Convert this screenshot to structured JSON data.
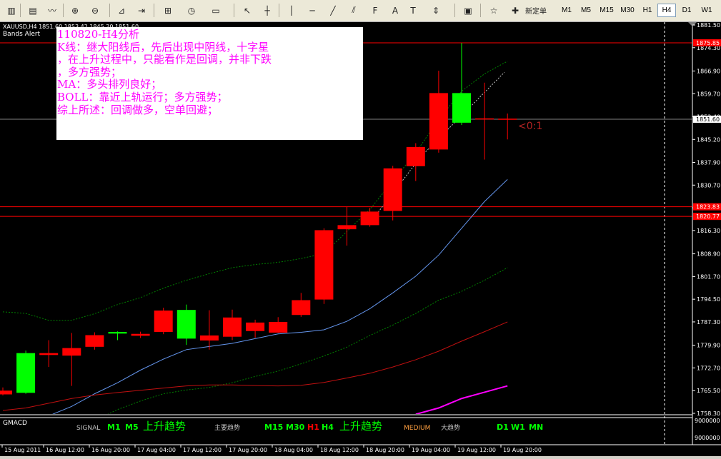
{
  "toolbar": {
    "buttons": [
      {
        "name": "bar-chart-icon",
        "glyph": "▥"
      },
      {
        "name": "candlestick-chart-icon",
        "glyph": "▤"
      },
      {
        "name": "line-chart-icon",
        "glyph": "〰"
      },
      {
        "name": "zoom-in-icon",
        "glyph": "⊕"
      },
      {
        "name": "zoom-out-icon",
        "glyph": "⊖"
      },
      {
        "name": "chart-shift-icon",
        "glyph": "⊿"
      },
      {
        "name": "autoscroll-icon",
        "glyph": "⇥"
      },
      {
        "name": "indicators-icon",
        "glyph": "⊞"
      },
      {
        "name": "periods-icon",
        "glyph": "◷"
      },
      {
        "name": "templates-icon",
        "glyph": "▭"
      },
      {
        "name": "cursor-icon",
        "glyph": "↖"
      },
      {
        "name": "crosshair-icon",
        "glyph": "┼"
      },
      {
        "name": "vertical-line-icon",
        "glyph": "│"
      },
      {
        "name": "horizontal-line-icon",
        "glyph": "─"
      },
      {
        "name": "trendline-icon",
        "glyph": "╱"
      },
      {
        "name": "equidistant-channel-icon",
        "glyph": "⫽"
      },
      {
        "name": "fibonacci-icon",
        "glyph": "F"
      },
      {
        "name": "text-icon",
        "glyph": "A"
      },
      {
        "name": "text-label-icon",
        "glyph": "T"
      },
      {
        "name": "arrows-icon",
        "glyph": "⇕"
      },
      {
        "name": "terminal-icon",
        "glyph": "▣"
      },
      {
        "name": "favorites-icon",
        "glyph": "☆"
      },
      {
        "name": "new-order-icon",
        "glyph": "✚"
      }
    ],
    "new_order_label": "新定单",
    "timeframes": [
      "M1",
      "M5",
      "M15",
      "M30",
      "H1",
      "H4",
      "D1",
      "W1"
    ],
    "active_timeframe": "H4"
  },
  "chart": {
    "symbol_line": "XAUUSD,H4  1851.60 1853.42 1845.20 1851.60",
    "indicator_name": "Bands Alert",
    "note_lines": [
      "110820-H4分析",
      "K线：继大阳线后，先后出现中阴线，十字星",
      "，在上升过程中，只能看作是回调，并非下跌",
      "，多方强势；",
      "MA：多头排列良好；",
      "BOLL：靠近上轨运行；多方强势；",
      "综上所述：回调做多，空单回避；"
    ],
    "price_ticks": [
      "1881.50",
      "1874.30",
      "1866.90",
      "1859.70",
      "1852.40",
      "1845.20",
      "1837.90",
      "1830.70",
      "1823.50",
      "1816.30",
      "1808.90",
      "1801.70",
      "1794.50",
      "1787.30",
      "1779.90",
      "1772.70",
      "1765.50",
      "1758.30"
    ],
    "price_labels": [
      {
        "text": "1875.85",
        "color": "#ff0000"
      },
      {
        "text": "1851.60",
        "color": "#ffffff"
      },
      {
        "text": "1823.83",
        "color": "#ff0000"
      },
      {
        "text": "1820.77",
        "color": "#ff0000"
      }
    ],
    "countdown": "<0:1",
    "sub_window": {
      "name": "GMACD",
      "ticks": [
        "9000000",
        "9000000"
      ],
      "items": [
        {
          "text": "SIGNAL",
          "color": "#c0c0c0",
          "size": 9
        },
        {
          "text": "M1",
          "color": "#00ff00",
          "size": 11
        },
        {
          "text": "M5",
          "color": "#00ff00",
          "size": 11
        },
        {
          "text": "上升趋势",
          "color": "#00ff00",
          "size": 15
        },
        {
          "text": "主要趋势",
          "color": "#c0c0c0",
          "size": 9
        },
        {
          "text": "M15",
          "color": "#00ff00",
          "size": 11
        },
        {
          "text": "M30",
          "color": "#00ff00",
          "size": 11
        },
        {
          "text": "H1",
          "color": "#ff0000",
          "size": 11
        },
        {
          "text": "H4",
          "color": "#00ff00",
          "size": 11
        },
        {
          "text": "上升趋势",
          "color": "#00ff00",
          "size": 15
        },
        {
          "text": "MEDIUM",
          "color": "#ffa040",
          "size": 9
        },
        {
          "text": "大趋势",
          "color": "#c0c0c0",
          "size": 9
        },
        {
          "text": "D1",
          "color": "#00ff00",
          "size": 11
        },
        {
          "text": "W1",
          "color": "#00ff00",
          "size": 11
        },
        {
          "text": "MN",
          "color": "#00ff00",
          "size": 11
        }
      ]
    },
    "time_ticks": [
      "15 Aug 2011",
      "16 Aug 12:00",
      "16 Aug 20:00",
      "17 Aug 04:00",
      "17 Aug 12:00",
      "17 Aug 20:00",
      "18 Aug 04:00",
      "18 Aug 12:00",
      "18 Aug 20:00",
      "19 Aug 04:00",
      "19 Aug 12:00",
      "19 Aug 20:00"
    ],
    "colors": {
      "bull": "#00ff00",
      "bear": "#ff0000",
      "ma_fast": "#6495ed",
      "boll_band": "#008000",
      "ma_slow": "#c01010",
      "ma_long": "#ff00ff",
      "level_line": "#ff0000",
      "grid": "#ffffff"
    }
  },
  "chart_data": {
    "type": "candlestick",
    "symbol": "XAUUSD",
    "timeframe": "H4",
    "ylim": [
      1758.3,
      1881.5
    ],
    "candles": [
      {
        "o": 1765.5,
        "h": 1766.5,
        "l": 1764.0,
        "c": 1764.3
      },
      {
        "o": 1764.8,
        "h": 1778.2,
        "l": 1764.5,
        "c": 1777.4
      },
      {
        "o": 1777.4,
        "h": 1781.5,
        "l": 1773.0,
        "c": 1776.8
      },
      {
        "o": 1779.0,
        "h": 1783.8,
        "l": 1767.0,
        "c": 1776.6
      },
      {
        "o": 1783.1,
        "h": 1784.0,
        "l": 1778.5,
        "c": 1779.4
      },
      {
        "o": 1783.6,
        "h": 1784.3,
        "l": 1781.5,
        "c": 1784.1
      },
      {
        "o": 1783.5,
        "h": 1784.2,
        "l": 1782.2,
        "c": 1782.9
      },
      {
        "o": 1790.9,
        "h": 1791.8,
        "l": 1783.4,
        "c": 1784.1
      },
      {
        "o": 1782.0,
        "h": 1792.8,
        "l": 1780.0,
        "c": 1791.1
      },
      {
        "o": 1783.0,
        "h": 1791.0,
        "l": 1778.5,
        "c": 1781.4
      },
      {
        "o": 1788.7,
        "h": 1791.2,
        "l": 1781.5,
        "c": 1782.6
      },
      {
        "o": 1787.1,
        "h": 1788.0,
        "l": 1782.3,
        "c": 1784.4
      },
      {
        "o": 1787.3,
        "h": 1788.8,
        "l": 1783.8,
        "c": 1783.9
      },
      {
        "o": 1794.2,
        "h": 1796.5,
        "l": 1788.9,
        "c": 1789.5
      },
      {
        "o": 1816.4,
        "h": 1817.0,
        "l": 1793.0,
        "c": 1794.4
      },
      {
        "o": 1818.0,
        "h": 1823.8,
        "l": 1811.5,
        "c": 1816.7
      },
      {
        "o": 1822.3,
        "h": 1823.5,
        "l": 1817.5,
        "c": 1818.0
      },
      {
        "o": 1836.0,
        "h": 1836.8,
        "l": 1819.5,
        "c": 1822.5
      },
      {
        "o": 1842.8,
        "h": 1844.0,
        "l": 1832.0,
        "c": 1836.7
      },
      {
        "o": 1859.9,
        "h": 1867.0,
        "l": 1841.0,
        "c": 1842.0
      },
      {
        "o": 1850.5,
        "h": 1875.8,
        "l": 1849.8,
        "c": 1859.9
      },
      {
        "o": 1851.7,
        "h": 1863.2,
        "l": 1838.8,
        "c": 1851.5
      },
      {
        "o": 1851.6,
        "h": 1853.4,
        "l": 1845.2,
        "c": 1851.6
      }
    ],
    "series": [
      {
        "name": "ma_fast",
        "values": [
          1754.5,
          1756.0,
          1757.5,
          1760.5,
          1764.5,
          1768.0,
          1772.0,
          1775.5,
          1778.5,
          1779.5,
          1780.5,
          1782.0,
          1783.5,
          1784.0,
          1784.8,
          1787.5,
          1791.5,
          1796.5,
          1801.8,
          1808.5,
          1817.0,
          1825.5,
          1832.5
        ]
      },
      {
        "name": "boll_upper",
        "values": [
          1790.5,
          1790.0,
          1787.8,
          1787.8,
          1789.9,
          1792.8,
          1795.0,
          1798.0,
          1800.5,
          1802.6,
          1804.5,
          1805.5,
          1806.2,
          1807.4,
          1809.0,
          1816.0,
          1823.0,
          1832.0,
          1841.0,
          1851.5,
          1860.5,
          1866.0,
          1870.0
        ]
      },
      {
        "name": "boll_lower",
        "values": [
          1750.0,
          1751.0,
          1751.5,
          1753.0,
          1756.0,
          1759.5,
          1762.2,
          1764.5,
          1765.7,
          1766.5,
          1768.0,
          1770.0,
          1771.7,
          1774.0,
          1776.5,
          1779.3,
          1783.0,
          1786.3,
          1790.0,
          1794.2,
          1797.0,
          1800.5,
          1804.5
        ]
      },
      {
        "name": "ma_slow",
        "values": [
          1759.2,
          1760.0,
          1761.5,
          1763.0,
          1764.1,
          1764.9,
          1765.6,
          1766.3,
          1767.0,
          1767.3,
          1767.3,
          1767.1,
          1767.0,
          1767.2,
          1768.1,
          1769.5,
          1771.0,
          1773.0,
          1775.3,
          1778.0,
          1781.2,
          1784.2,
          1787.3
        ]
      },
      {
        "name": "ma_long",
        "values": [
          null,
          null,
          null,
          null,
          null,
          null,
          null,
          null,
          null,
          null,
          null,
          null,
          null,
          null,
          null,
          null,
          null,
          null,
          1758.0,
          1760.0,
          1763.0,
          1765.0,
          1767.0
        ]
      }
    ],
    "levels": [
      1875.85,
      1851.6,
      1823.83,
      1820.77
    ]
  }
}
